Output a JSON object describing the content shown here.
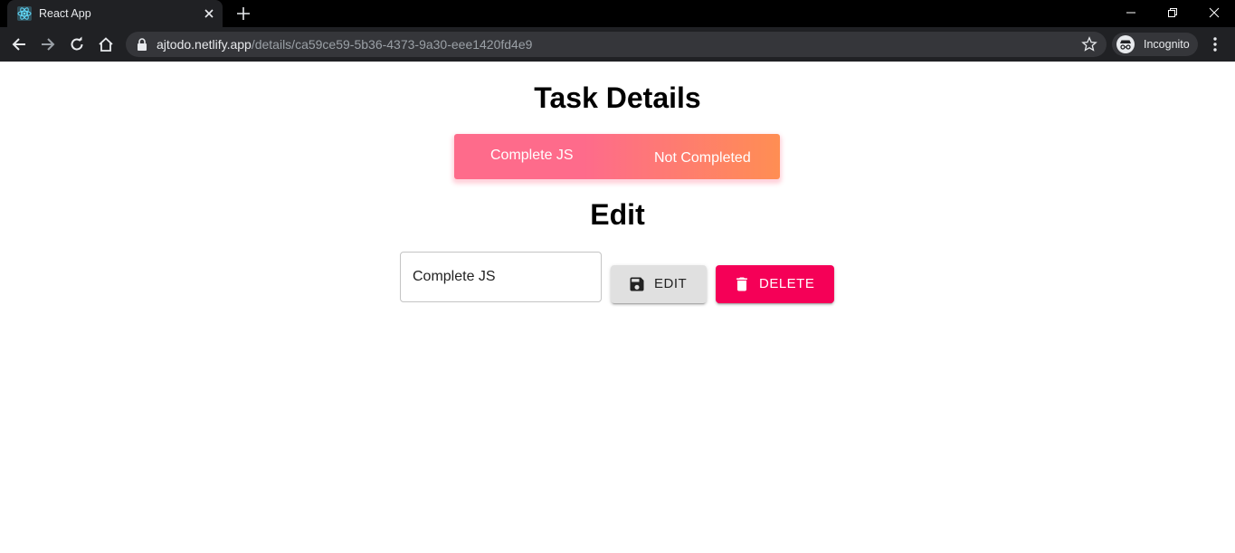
{
  "browser": {
    "tab_title": "React App",
    "url_host": "ajtodo.netlify.app",
    "url_path": "/details/ca59ce59-5b36-4373-9a30-eee1420fd4e9",
    "profile_label": "Incognito"
  },
  "page": {
    "title": "Task Details",
    "task": {
      "name": "Complete JS",
      "status": "Not Completed"
    },
    "edit_heading": "Edit",
    "edit_input_value": "Complete JS",
    "edit_button_label": "EDIT",
    "delete_button_label": "DELETE"
  },
  "colors": {
    "card_gradient_start": "#fe6b8b",
    "card_gradient_end": "#ff8e53",
    "delete_button": "#f50057",
    "edit_button": "#e0e0e0"
  },
  "icons": {
    "tab_favicon": "react-icon",
    "edit_button": "save-icon",
    "delete_button": "trash-icon"
  }
}
